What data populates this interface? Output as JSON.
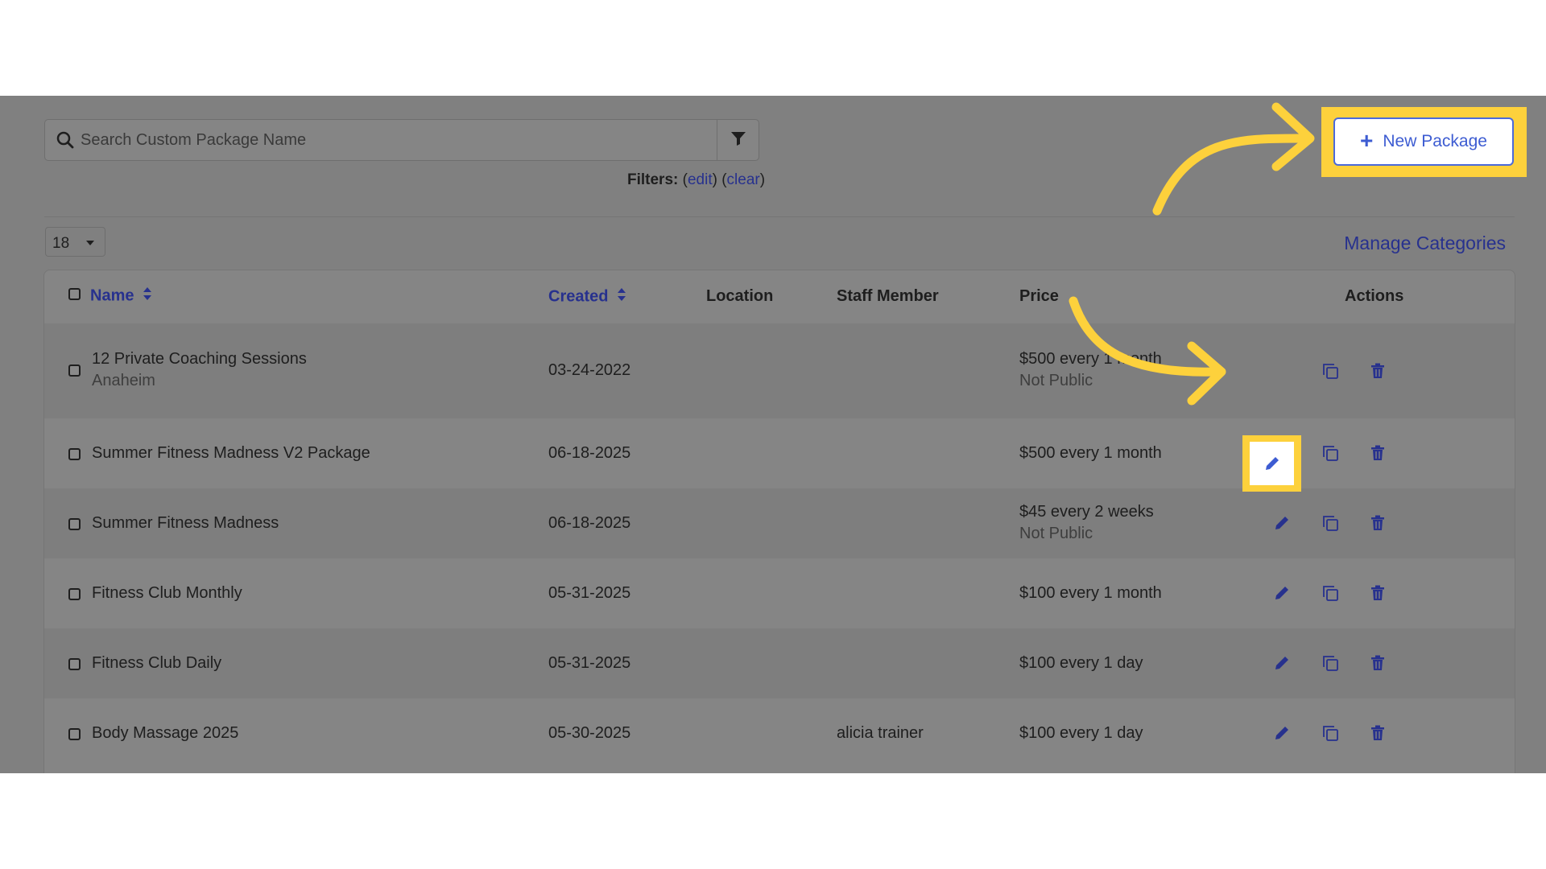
{
  "search": {
    "placeholder": "Search Custom Package Name"
  },
  "filters": {
    "label": "Filters:",
    "edit": "edit",
    "clear": "clear"
  },
  "toolbar": {
    "per_page": "18",
    "manage_categories": "Manage Categories",
    "new_package_label": "New Package"
  },
  "table": {
    "headers": {
      "name": "Name",
      "created": "Created",
      "location": "Location",
      "staff": "Staff Member",
      "price": "Price",
      "actions": "Actions"
    },
    "rows": [
      {
        "name": "12 Private Coaching Sessions",
        "name_sub": "Anaheim",
        "created": "03-24-2022",
        "staff": "",
        "price": "$500 every 1 month",
        "price_sub": "Not Public"
      },
      {
        "name": "Summer Fitness Madness V2 Package",
        "name_sub": "",
        "created": "06-18-2025",
        "staff": "",
        "price": "$500 every 1 month",
        "price_sub": ""
      },
      {
        "name": "Summer Fitness Madness",
        "name_sub": "",
        "created": "06-18-2025",
        "staff": "",
        "price": "$45 every 2 weeks",
        "price_sub": "Not Public"
      },
      {
        "name": "Fitness Club Monthly",
        "name_sub": "",
        "created": "05-31-2025",
        "staff": "",
        "price": "$100 every 1 month",
        "price_sub": ""
      },
      {
        "name": "Fitness Club Daily",
        "name_sub": "",
        "created": "05-31-2025",
        "staff": "",
        "price": "$100 every 1 day",
        "price_sub": ""
      },
      {
        "name": "Body Massage 2025",
        "name_sub": "",
        "created": "05-30-2025",
        "staff": "alicia trainer",
        "price": "$100 every 1 day",
        "price_sub": ""
      }
    ]
  },
  "icons": {
    "search": "search-icon",
    "filter": "filter-icon",
    "edit": "pencil-icon",
    "copy": "copy-icon",
    "delete": "trash-icon",
    "sort": "sort-icon",
    "plus": "plus-icon"
  },
  "colors": {
    "accent": "#3d5cd2",
    "link": "#27318e",
    "highlight": "#fdd13c",
    "overlay": "#808080"
  }
}
